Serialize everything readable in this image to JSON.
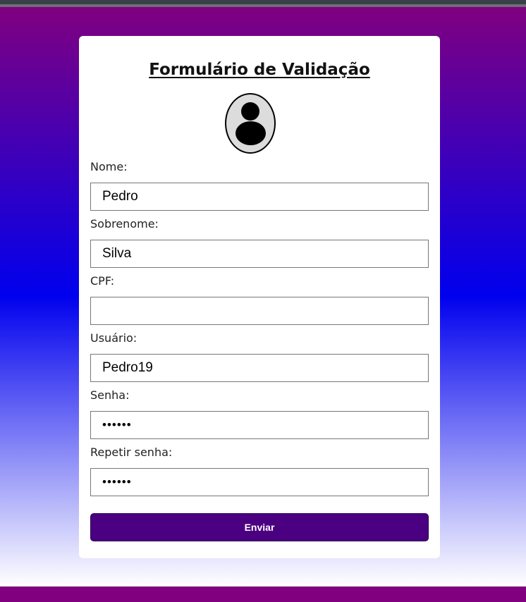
{
  "form": {
    "title": "Formulário de Validação",
    "fields": [
      {
        "label": "Nome:",
        "value": "Pedro",
        "type": "text"
      },
      {
        "label": "Sobrenome:",
        "value": "Silva",
        "type": "text"
      },
      {
        "label": "CPF:",
        "value": "",
        "type": "text"
      },
      {
        "label": "Usuário:",
        "value": "Pedro19",
        "type": "text"
      },
      {
        "label": "Senha:",
        "value": "pedro1",
        "type": "password"
      },
      {
        "label": "Repetir senha:",
        "value": "pedro1",
        "type": "password"
      }
    ],
    "submit_label": "Enviar"
  },
  "icons": {
    "avatar": "user-avatar-icon"
  },
  "colors": {
    "background_top": "#800080",
    "background_middle": "#0000ee",
    "background_bottom": "#ffffff",
    "button": "#4b0082",
    "card": "#ffffff"
  }
}
